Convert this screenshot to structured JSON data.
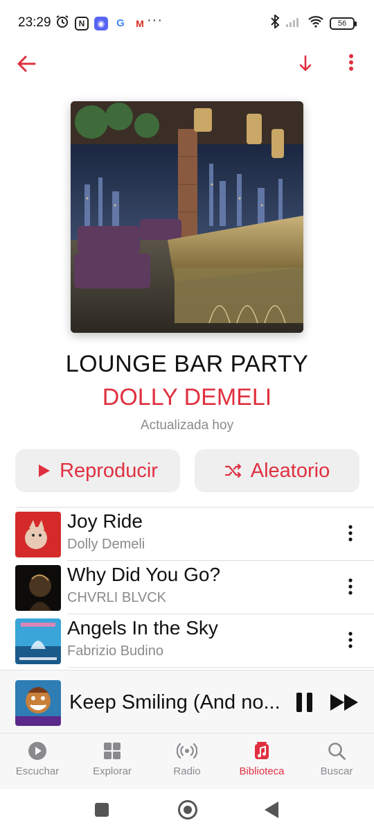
{
  "status_bar": {
    "time": "23:29",
    "battery": "56",
    "more": "···"
  },
  "playlist": {
    "title": "LOUNGE BAR PARTY",
    "artist": "DOLLY DEMELI",
    "updated": "Actualizada hoy"
  },
  "actions": {
    "play_label": "Reproducir",
    "shuffle_label": "Aleatorio"
  },
  "tracks": [
    {
      "title": "Joy Ride",
      "artist": "Dolly Demeli"
    },
    {
      "title": "Why Did You Go?",
      "artist": "CHVRLI BLVCK"
    },
    {
      "title": "Angels In the Sky",
      "artist": "Fabrizio Budino"
    }
  ],
  "now_playing": {
    "title": "Keep Smiling (And no..."
  },
  "tabs": [
    {
      "label": "Escuchar",
      "icon": "play-circle-icon",
      "active": false
    },
    {
      "label": "Explorar",
      "icon": "grid-icon",
      "active": false
    },
    {
      "label": "Radio",
      "icon": "radio-icon",
      "active": false
    },
    {
      "label": "Biblioteca",
      "icon": "library-music-icon",
      "active": true
    },
    {
      "label": "Buscar",
      "icon": "search-icon",
      "active": false
    }
  ],
  "colors": {
    "accent": "#e0303f",
    "secondary_text": "#8a8a8e",
    "button_bg": "#efeff0"
  }
}
